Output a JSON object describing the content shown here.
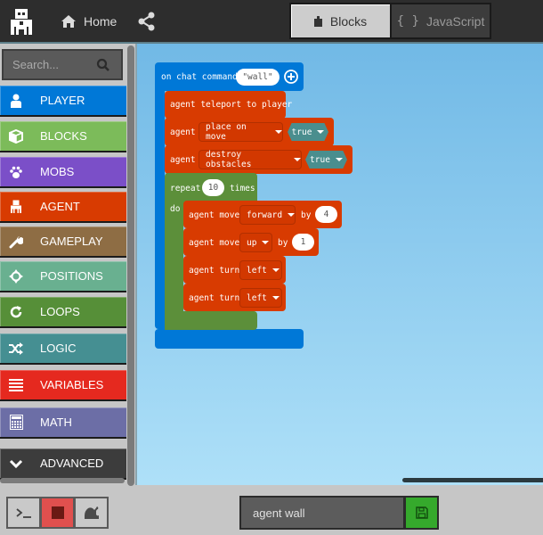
{
  "header": {
    "logo": "agent-logo-icon",
    "home_label": "Home",
    "share": "share-icon",
    "tabs": [
      {
        "label": "Blocks",
        "icon": "puzzle-icon",
        "active": true
      },
      {
        "label": "JavaScript",
        "icon": "braces-icon",
        "active": false
      }
    ]
  },
  "sidebar": {
    "search_placeholder": "Search...",
    "categories": [
      {
        "label": "PLAYER",
        "icon": "person-icon",
        "color": "#0078d7"
      },
      {
        "label": "BLOCKS",
        "icon": "cube-icon",
        "color": "#7cbb5a"
      },
      {
        "label": "MOBS",
        "icon": "paw-icon",
        "color": "#7b4fc8"
      },
      {
        "label": "AGENT",
        "icon": "agent-icon",
        "color": "#d83b01"
      },
      {
        "label": "GAMEPLAY",
        "icon": "wrench-icon",
        "color": "#8e6d44"
      },
      {
        "label": "POSITIONS",
        "icon": "crosshair-icon",
        "color": "#69b090"
      },
      {
        "label": "LOOPS",
        "icon": "loop-icon",
        "color": "#568f38"
      },
      {
        "label": "LOGIC",
        "icon": "shuffle-icon",
        "color": "#458f92"
      },
      {
        "label": "VARIABLES",
        "icon": "list-icon",
        "color": "#e5291f"
      },
      {
        "label": "MATH",
        "icon": "calculator-icon",
        "color": "#6c6ea6"
      },
      {
        "label": "ADVANCED",
        "icon": "chevron-down-icon",
        "color": "#3c3c3c"
      }
    ]
  },
  "workspace": {
    "event": {
      "label": "on chat command",
      "value": "\"wall\"",
      "add_icon": "plus-circle-icon"
    },
    "statements": {
      "teleport": "agent teleport to player",
      "place": {
        "prefix": "agent",
        "option": "place on move",
        "value": "true"
      },
      "destroy": {
        "prefix": "agent",
        "option": "destroy obstacles",
        "value": "true"
      },
      "repeat": {
        "label": "repeat",
        "count": "10",
        "suffix": "times",
        "do": "do"
      },
      "move1": {
        "prefix": "agent move",
        "direction": "forward",
        "by": "by",
        "amount": "4"
      },
      "move2": {
        "prefix": "agent move",
        "direction": "up",
        "by": "by",
        "amount": "1"
      },
      "turn1": {
        "prefix": "agent turn",
        "direction": "left"
      },
      "turn2": {
        "prefix": "agent turn",
        "direction": "left"
      }
    }
  },
  "footer": {
    "terminal_icon": "terminal-icon",
    "stop_icon": "stop-icon",
    "slow_icon": "snail-icon",
    "project_name": "agent wall",
    "save_icon": "save-icon"
  }
}
